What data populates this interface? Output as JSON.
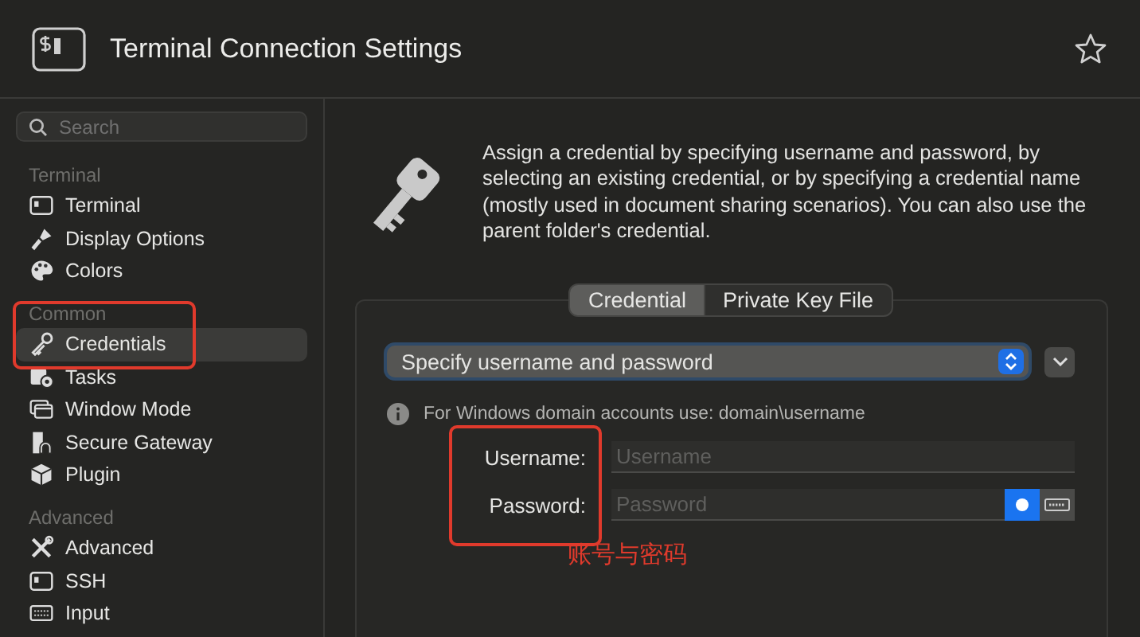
{
  "window": {
    "title": "Terminal Connection Settings"
  },
  "sidebar": {
    "search": {
      "placeholder": "Search"
    },
    "sections": [
      {
        "title": "Terminal",
        "items": [
          {
            "label": "Terminal",
            "selected": false
          },
          {
            "label": "Display Options",
            "selected": false
          },
          {
            "label": "Colors",
            "selected": false
          }
        ]
      },
      {
        "title": "Common",
        "items": [
          {
            "label": "Credentials",
            "selected": true
          },
          {
            "label": "Tasks",
            "selected": false
          },
          {
            "label": "Window Mode",
            "selected": false
          },
          {
            "label": "Secure Gateway",
            "selected": false
          },
          {
            "label": "Plugin",
            "selected": false
          }
        ]
      },
      {
        "title": "Advanced",
        "items": [
          {
            "label": "Advanced",
            "selected": false
          },
          {
            "label": "SSH",
            "selected": false
          },
          {
            "label": "Input",
            "selected": false
          }
        ]
      }
    ]
  },
  "description": "Assign a credential by specifying username and password, by selecting an existing credential, or by specifying a credential name (mostly used in document sharing scenarios). You can also use the parent folder's credential.",
  "tabs": [
    {
      "label": "Credential",
      "selected": true
    },
    {
      "label": "Private Key File",
      "selected": false
    }
  ],
  "credential_type": {
    "value": "Specify username and password"
  },
  "hint": "For Windows domain accounts use: domain\\username",
  "fields": [
    {
      "label": "Username:",
      "placeholder": "Username",
      "kind": "text"
    },
    {
      "label": "Password:",
      "placeholder": "Password",
      "kind": "password"
    }
  ],
  "annotation": "账号与密码"
}
